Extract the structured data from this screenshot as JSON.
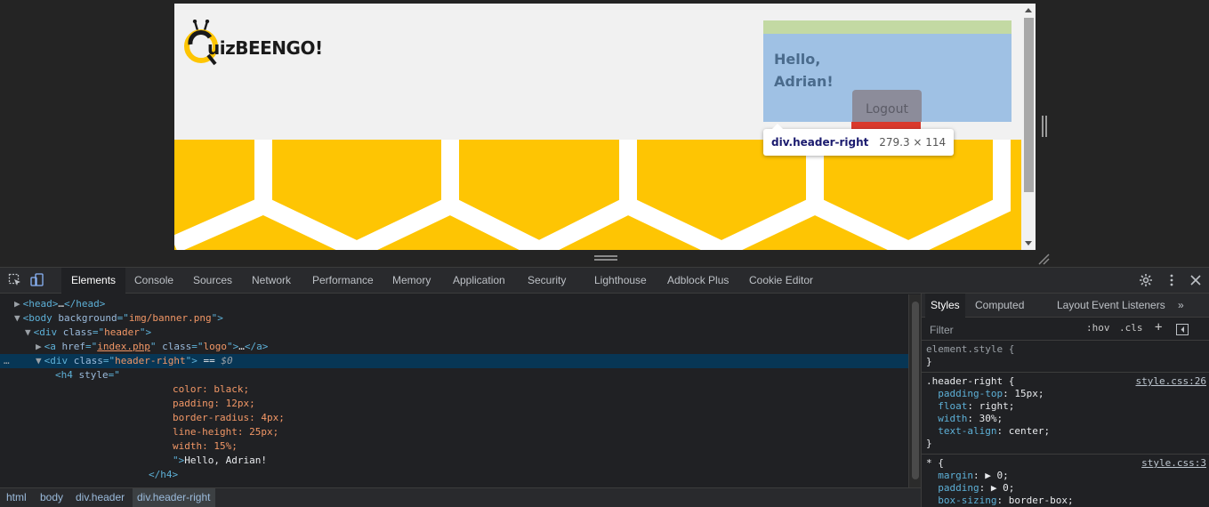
{
  "page": {
    "logo_text": "uizBEENGO!",
    "greeting": "Hello, Adrian!",
    "logout_label": "Logout",
    "inspect_tooltip": {
      "selector": "div.header-right",
      "size": "279.3 × 114"
    }
  },
  "devtools": {
    "tabs": [
      "Elements",
      "Console",
      "Sources",
      "Network",
      "Performance",
      "Memory",
      "Application",
      "Security",
      "Lighthouse",
      "Adblock Plus",
      "Cookie Editor"
    ],
    "active_tab": "Elements",
    "dom_lines": [
      {
        "parts": [
          [
            "tri",
            "▶"
          ],
          [
            "tag",
            "<head>"
          ],
          [
            "txt",
            "…"
          ],
          [
            "tag",
            "</head>"
          ]
        ]
      },
      {
        "parts": [
          [
            "tri",
            "▼"
          ],
          [
            "tag",
            "<body "
          ],
          [
            "attr",
            "background"
          ],
          [
            "tag",
            "=\""
          ],
          [
            "val",
            "img/banner.png"
          ],
          [
            "tag",
            "\">"
          ]
        ]
      },
      {
        "parts": [
          [
            "tri",
            "▼"
          ],
          [
            "tag",
            "<div "
          ],
          [
            "attr",
            "class"
          ],
          [
            "tag",
            "=\""
          ],
          [
            "val",
            "header"
          ],
          [
            "tag",
            "\">"
          ]
        ]
      },
      {
        "parts": [
          [
            "tri",
            "▶"
          ],
          [
            "tag",
            "<a "
          ],
          [
            "attr",
            "href"
          ],
          [
            "tag",
            "=\""
          ],
          [
            "valul",
            "index.php"
          ],
          [
            "tag",
            "\" "
          ],
          [
            "attr",
            "class"
          ],
          [
            "tag",
            "=\""
          ],
          [
            "val",
            "logo"
          ],
          [
            "tag",
            "\">"
          ],
          [
            "txt",
            "…"
          ],
          [
            "tag",
            "</a>"
          ]
        ]
      },
      {
        "parts": [
          [
            "tri",
            "▼"
          ],
          [
            "tag",
            "<div "
          ],
          [
            "attr",
            "class"
          ],
          [
            "tag",
            "=\""
          ],
          [
            "val",
            "header-right"
          ],
          [
            "tag",
            "\">"
          ],
          [
            "txt",
            " == "
          ],
          [
            "dollar",
            "$0"
          ]
        ]
      },
      {
        "parts": [
          [
            "tag",
            "<h4 "
          ],
          [
            "attr",
            "style"
          ],
          [
            "tag",
            "=\""
          ]
        ]
      },
      {
        "parts": [
          [
            "css",
            "color: black;"
          ]
        ]
      },
      {
        "parts": [
          [
            "css",
            "padding: 12px;"
          ]
        ]
      },
      {
        "parts": [
          [
            "css",
            "border-radius: 4px;"
          ]
        ]
      },
      {
        "parts": [
          [
            "css",
            "line-height: 25px;"
          ]
        ]
      },
      {
        "parts": [
          [
            "css",
            "width: 15%;"
          ]
        ]
      },
      {
        "parts": [
          [
            "tag",
            "\">"
          ],
          [
            "txt",
            "Hello, Adrian!"
          ]
        ]
      },
      {
        "parts": [
          [
            "tag",
            "</h4>"
          ]
        ]
      }
    ],
    "selected_line_marker": "…",
    "breadcrumbs": [
      "html",
      "body",
      "div.header",
      "div.header-right"
    ],
    "styles": {
      "tabs": [
        "Styles",
        "Computed",
        "Layout",
        "Event Listeners"
      ],
      "more_tabs": "»",
      "filter_placeholder": "Filter",
      "hov": ":hov",
      "cls": ".cls",
      "plus": "+",
      "element_style_selector": "element.style {",
      "close_brace": "}",
      "rule1": {
        "selector": ".header-right {",
        "source": "style.css:26",
        "props": [
          [
            "padding-top",
            "15px;"
          ],
          [
            "float",
            "right;"
          ],
          [
            "width",
            "30%;"
          ],
          [
            "text-align",
            "center;"
          ]
        ]
      },
      "rule2": {
        "selector": "* {",
        "source": "style.css:3",
        "props": [
          [
            "margin",
            "▶ 0;"
          ],
          [
            "padding",
            "▶ 0;"
          ],
          [
            "box-sizing",
            "border-box;"
          ]
        ]
      }
    }
  },
  "colors": {
    "honey": "#fec503",
    "padding_highlight": "#c3d9a3",
    "content_highlight": "#9fc1e4",
    "margin_highlight": "#d93a2c",
    "devtools_bg": "#202124",
    "selected_row": "#073655"
  }
}
